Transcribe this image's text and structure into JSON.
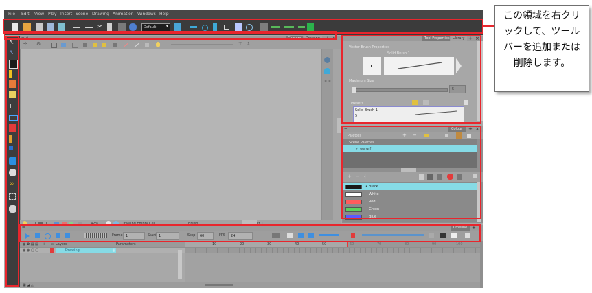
{
  "menubar": {
    "items": [
      "File",
      "Edit",
      "View",
      "Play",
      "Insert",
      "Scene",
      "Drawing",
      "Animation",
      "Windows",
      "Help"
    ]
  },
  "toolbar": {
    "preset_dropdown": "Default"
  },
  "camera_view": {
    "tabs": [
      "Camera",
      "Drawing"
    ],
    "status": {
      "zoom": "42%",
      "drawing": "Drawing Empty Cell",
      "brush": "Brush",
      "frame": "Fr 1"
    }
  },
  "tool_properties": {
    "tabs": [
      "Tool Properties",
      "Library"
    ],
    "vector_brush_label": "Vector Brush Properties",
    "brush_name": "Solid Brush 1",
    "max_size_label": "Maximum Size",
    "max_size_value": "5",
    "presets_label": "Presets",
    "preset_item": "Solid Brush 1",
    "preset_item_size": "5"
  },
  "colour": {
    "tab": "Colour",
    "palettes_label": "Palettes",
    "scene_palettes": "Scene Palettes",
    "palette_item": "wergrf",
    "swatches": [
      {
        "name": "Black",
        "color": "#1a1a1a"
      },
      {
        "name": "White",
        "color": "#ffffff"
      },
      {
        "name": "Red",
        "color": "#ff5c5c"
      },
      {
        "name": "Green",
        "color": "#5bd35b"
      },
      {
        "name": "Blue",
        "color": "#5a5aff"
      }
    ]
  },
  "timeline": {
    "tab": "Timeline",
    "frame_label": "Frame",
    "frame_value": "1",
    "start_label": "Start",
    "start_value": "1",
    "stop_label": "Stop",
    "stop_value": "60",
    "fps_label": "FPS",
    "fps_value": "24",
    "col_layers": "Layers",
    "col_params": "Parameters",
    "layer_name": "Drawing",
    "ruler": [
      "10",
      "20",
      "30",
      "40",
      "50",
      "60",
      "70",
      "80",
      "90",
      "100"
    ]
  },
  "callout": {
    "text": "この領域を右クリックして、ツールバーを追加または削除します。"
  },
  "colors": {
    "highlight_red": "#e8262d",
    "selection_cyan": "#86dbe6"
  }
}
